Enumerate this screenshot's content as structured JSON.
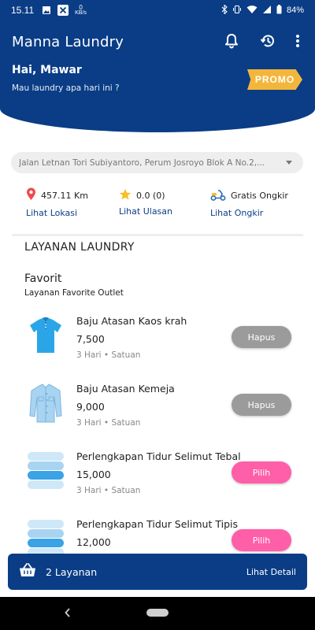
{
  "status_bar": {
    "time": "15.11",
    "speed_value": "0",
    "speed_unit": "KB/s",
    "battery": "84%",
    "icons": [
      "image-icon",
      "x-icon",
      "bluetooth-icon",
      "vibrate-icon",
      "wifi-icon",
      "signal-icon",
      "battery-icon"
    ]
  },
  "header": {
    "title": "Manna Laundry",
    "greeting": "Hai, Mawar",
    "subtitle": "Mau laundry apa hari ini ?",
    "promo_label": "PROMO",
    "icons": [
      "bell-icon",
      "history-icon",
      "more-vert-icon"
    ]
  },
  "address": {
    "text": "Jalan Letnan Tori Subiyantoro, Perum Josroyo Blok A No.2,..."
  },
  "info": {
    "distance": {
      "value": "457.11 Km",
      "link": "Lihat Lokasi",
      "icon": "location-pin-icon"
    },
    "rating": {
      "value": "0.0 (0)",
      "link": "Lihat Ulasan",
      "icon": "star-icon"
    },
    "shipping": {
      "value": "Gratis Ongkir",
      "link": "Lihat Ongkir",
      "icon": "scooter-icon"
    }
  },
  "services": {
    "section_title": "LAYANAN LAUNDRY",
    "favorite_title": "Favorit",
    "favorite_subtitle": "Layanan Favorite Outlet",
    "items": [
      {
        "name": "Baju Atasan Kaos krah",
        "price": "7,500",
        "meta": "3 Hari • Satuan",
        "button": "Hapus",
        "image": "polo-shirt-icon"
      },
      {
        "name": "Baju Atasan Kemeja",
        "price": "9,000",
        "meta": "3 Hari • Satuan",
        "button": "Hapus",
        "image": "dress-shirt-icon"
      },
      {
        "name": "Perlengkapan Tidur Selimut Tebal",
        "price": "15,000",
        "meta": "3 Hari • Satuan",
        "button": "Pilih",
        "image": "blanket-stack-icon"
      },
      {
        "name": "Perlengkapan Tidur Selimut Tipis",
        "price": "12,000",
        "meta": "",
        "button": "Pilih",
        "image": "blanket-stack-icon"
      }
    ]
  },
  "cart": {
    "count_label": "2 Layanan",
    "detail_label": "Lihat Detail",
    "icon": "basket-icon"
  },
  "colors": {
    "primary": "#0a3d86",
    "promo": "#f4b63a",
    "pick_button": "#ff5ea8",
    "remove_button": "#9b9b9b"
  }
}
